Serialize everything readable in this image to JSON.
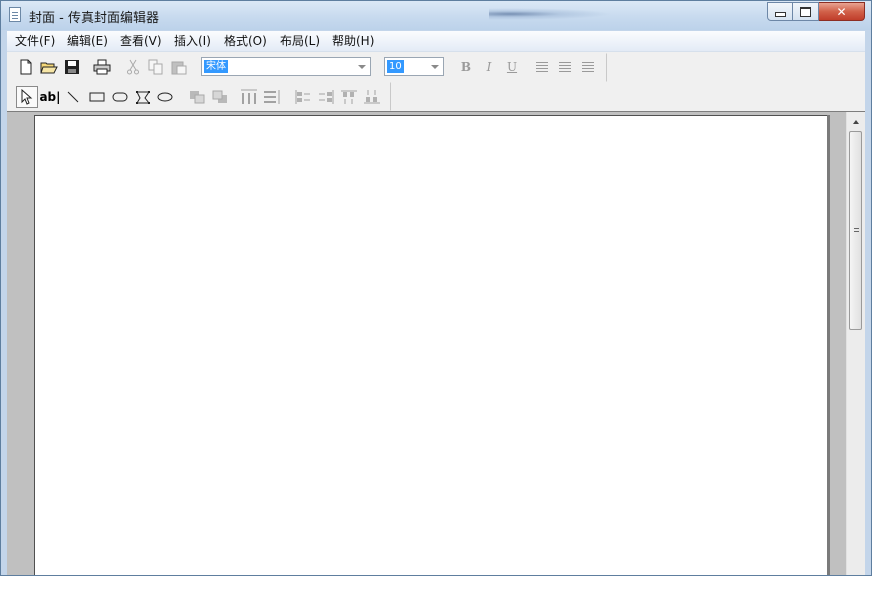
{
  "window": {
    "title": "封面 - 传真封面编辑器",
    "close_glyph": "✕"
  },
  "menu": {
    "items": [
      {
        "label": "文件(F)"
      },
      {
        "label": "编辑(E)"
      },
      {
        "label": "查看(V)"
      },
      {
        "label": "插入(I)"
      },
      {
        "label": "格式(O)"
      },
      {
        "label": "布局(L)"
      },
      {
        "label": "帮助(H)"
      }
    ]
  },
  "toolbar": {
    "font_name": "宋体",
    "font_size": "10",
    "bold": "B",
    "italic": "I",
    "underline": "U",
    "text_tool": "ab|"
  },
  "colors": {
    "selection": "#3399ff",
    "close_button": "#c03e2a"
  }
}
